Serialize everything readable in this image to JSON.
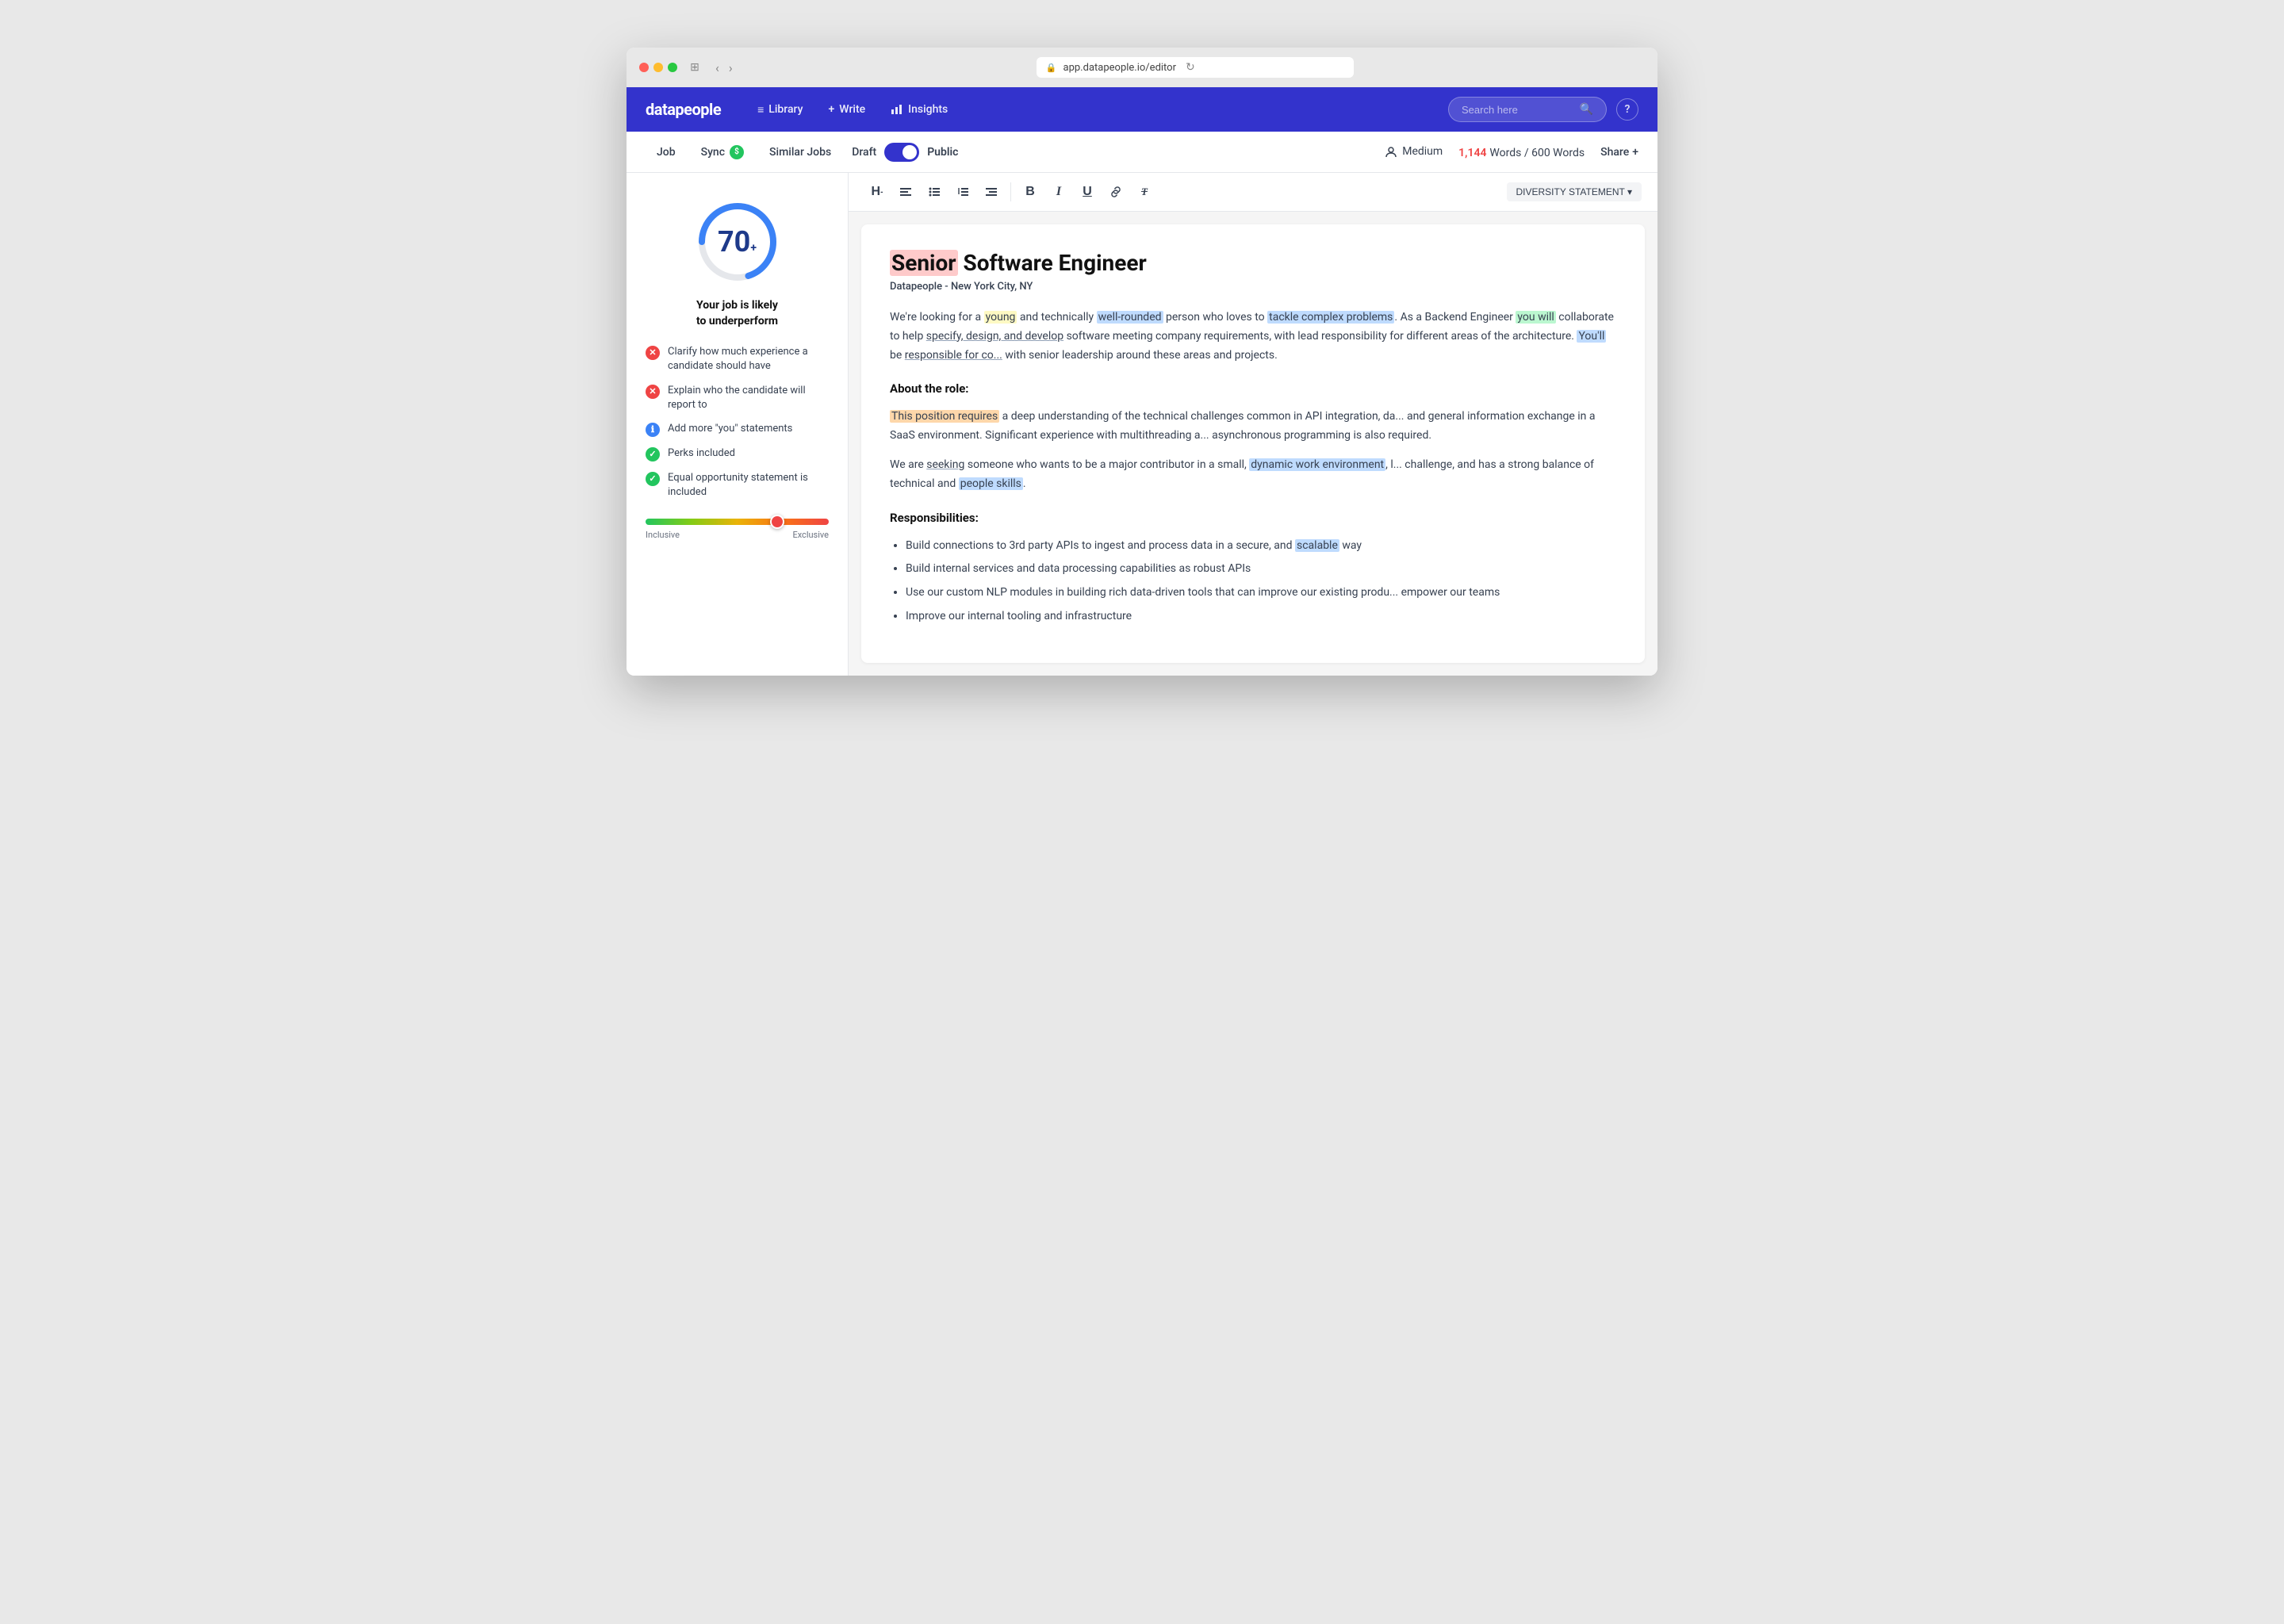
{
  "browser": {
    "address": "app.datapeople.io/editor"
  },
  "nav": {
    "logo": "datapeople",
    "items": [
      {
        "id": "library",
        "label": "Library",
        "icon": "≡"
      },
      {
        "id": "write",
        "label": "Write",
        "icon": "+"
      },
      {
        "id": "insights",
        "label": "Insights",
        "icon": "📊"
      }
    ],
    "search_placeholder": "Search here",
    "help_label": "?"
  },
  "secondary_nav": {
    "items": [
      {
        "id": "job",
        "label": "Job"
      },
      {
        "id": "sync",
        "label": "Sync",
        "badge": "$"
      },
      {
        "id": "similar_jobs",
        "label": "Similar Jobs"
      }
    ],
    "draft_label": "Draft",
    "public_label": "Public",
    "audience_label": "Medium",
    "word_count": "1,144",
    "word_limit": "600 Words",
    "share_label": "Share"
  },
  "score_panel": {
    "score": "70",
    "score_sup": "+",
    "performance_label": "Your job is likely\nto underperform",
    "checklist": [
      {
        "type": "red",
        "text": "Clarify how much experience a candidate should have"
      },
      {
        "type": "red",
        "text": "Explain who the candidate will report to"
      },
      {
        "type": "blue",
        "text": "Add more \"you\" statements"
      },
      {
        "type": "green",
        "text": "Perks included"
      },
      {
        "type": "green",
        "text": "Equal opportunity statement is included"
      }
    ],
    "slider_label_left": "Inclusive",
    "slider_label_right": "Exclusive"
  },
  "toolbar": {
    "buttons": [
      "H-",
      "≡",
      "☰",
      "⬌",
      "⬍",
      "B",
      "I",
      "U",
      "🔗",
      "T"
    ],
    "diversity_btn": "DIVERSITY STATEMENT ▾"
  },
  "editor": {
    "job_title_prefix": "Senior",
    "job_title_suffix": " Software Engineer",
    "company": "Datapeople",
    "location": "- New York City, NY",
    "body_paragraphs": [
      "We're looking for a young and technically well-rounded person who loves to tackle complex problems. As a Backend Engineer you will collaborate to help specify, design, and develop software meeting company requirements, with lead responsibility for different areas of the architecture. You'll be responsible for co... with senior leadership around these areas and projects.",
      "About the role:",
      "This position requires a deep understanding of the technical challenges common in API integration, da... and general information exchange in a SaaS environment. Significant experience with multithreading a... asynchronous programming is also required.",
      "We are seeking someone who wants to be a major contributor in a small, dynamic work environment, l... challenge, and has a strong balance of technical and people skills.",
      "Responsibilities:",
      "Build connections to 3rd party APIs to ingest and process data in a secure, and scalable way",
      "Build internal services and data processing capabilities as robust APIs",
      "Use our custom NLP modules in building rich data-driven tools that can improve our existing produ... empower our teams",
      "Improve our internal tooling and infrastructure"
    ]
  }
}
